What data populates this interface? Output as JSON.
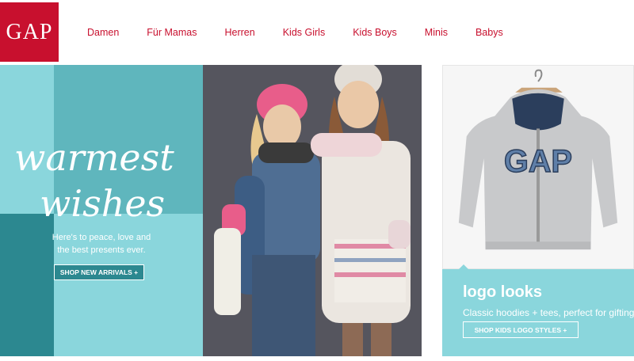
{
  "brand": {
    "logo_text": "GAP",
    "color": "#c8102e"
  },
  "nav": {
    "items": [
      "Damen",
      "Für Mamas",
      "Herren",
      "Kids Girls",
      "Kids Boys",
      "Minis",
      "Babys"
    ]
  },
  "hero": {
    "script_line1": "warmest",
    "script_line2": "wishes",
    "tagline_line1": "Here's to peace, love and",
    "tagline_line2": "the best presents ever.",
    "cta": "SHOP NEW ARRIVALS +"
  },
  "promo": {
    "title": "logo looks",
    "subtitle": "Classic hoodies + tees, perfect for gifting",
    "cta": "SHOP KIDS LOGO STYLES +",
    "product_print": "GAP"
  },
  "colors": {
    "teal_light": "#8ad6dc",
    "teal_mid": "#5fb6bd",
    "teal_dark": "#2c8890",
    "brand_red": "#c8102e"
  }
}
